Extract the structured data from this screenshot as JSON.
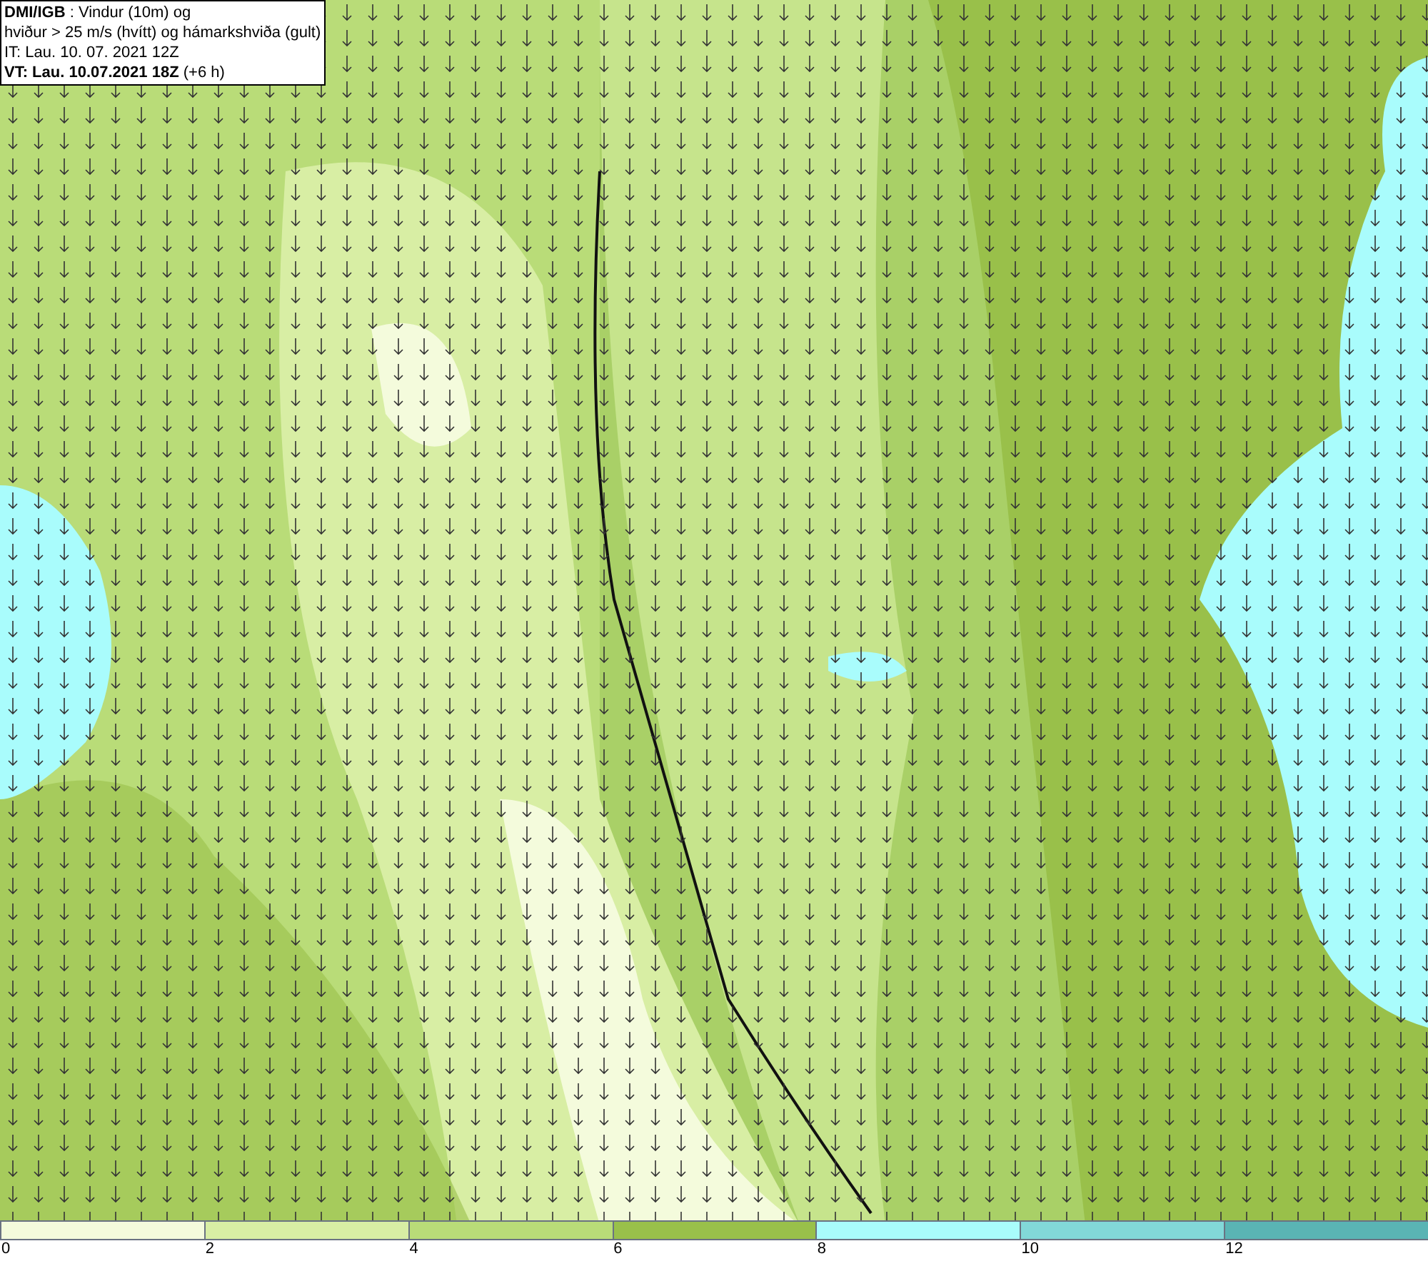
{
  "header": {
    "lines": [
      "**DMI/IGB** : Vindur (10m) og",
      "hviður > 25 m/s (hvítt) og hámarkshviða (gult)",
      "IT: Lau. 10. 07. 2021 12Z",
      "**VT: Lau. 10.07.2021 18Z** (+6 h)"
    ]
  },
  "legend": [
    {
      "label": "0",
      "color": "#f4fbdc"
    },
    {
      "label": "2",
      "color": "#d8eea4"
    },
    {
      "label": "4",
      "color": "#b9dc78"
    },
    {
      "label": "6",
      "color": "#99c04a"
    },
    {
      "label": "8",
      "color": "#a9fcfc"
    },
    {
      "label": "10",
      "color": "#82d8d8"
    },
    {
      "label": "12",
      "color": "#5ab4b4"
    }
  ]
}
